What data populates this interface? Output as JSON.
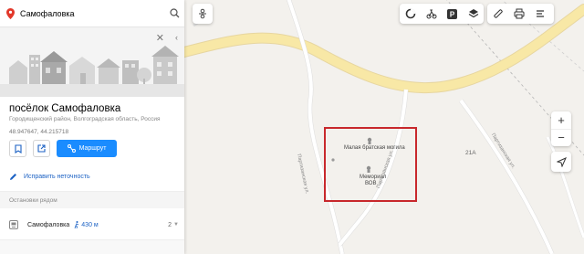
{
  "search": {
    "query": "Самофаловка",
    "pin_icon": "map-pin-icon",
    "search_icon": "search-icon"
  },
  "place": {
    "title": "посёлок Самофаловка",
    "subtitle": "Городищенский район, Волгоградская область, Россия",
    "coords": "48.947647, 44.215718"
  },
  "actions": {
    "route_label": "Маршрут",
    "fix_label": "Исправить неточность"
  },
  "stops": {
    "header": "Остановки рядом",
    "items": [
      {
        "name": "Самофаловка",
        "distance": "430 м",
        "routes": "2"
      }
    ]
  },
  "map": {
    "poi": [
      {
        "label": "Малая братская могила"
      },
      {
        "label_line1": "Мемориал",
        "label_line2": "ВОВ"
      }
    ],
    "house_number": "21А",
    "streets": {
      "left": "Партизанская ул.",
      "center": "Партизанская ул.",
      "right": "Партизанская ул."
    },
    "highlight_color": "#c8282c",
    "road_color": "#f7e6a4"
  },
  "controls": {
    "top_center_icon": "traffic-jams-icon",
    "layers": [
      "panorama-icon",
      "transport-icon",
      "parking-icon",
      "layers-icon"
    ],
    "tools": [
      "ruler-icon",
      "print-icon",
      "menu-icon"
    ],
    "zoom_in": "+",
    "zoom_out": "−"
  }
}
